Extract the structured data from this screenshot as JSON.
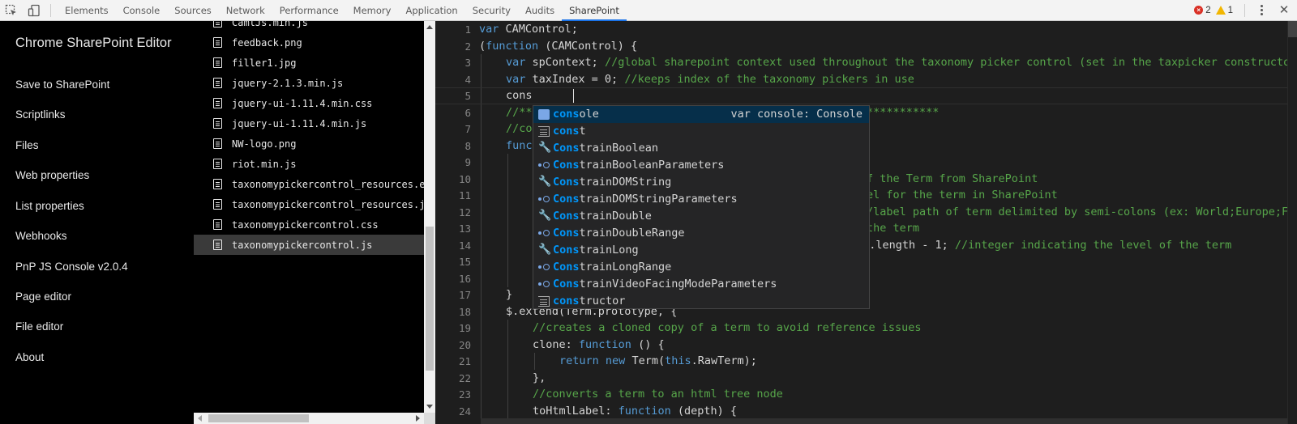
{
  "toolbar": {
    "tabs": [
      "Elements",
      "Console",
      "Sources",
      "Network",
      "Performance",
      "Memory",
      "Application",
      "Security",
      "Audits",
      "SharePoint"
    ],
    "active_tab": "SharePoint",
    "error_count": "2",
    "warning_count": "1",
    "colors": {
      "active_tab_underline": "#1a73e8",
      "error": "#d93025",
      "warning": "#f2b600"
    },
    "icons": [
      "inspect-element-icon",
      "device-toggle-icon",
      "error-icon",
      "warning-icon",
      "more-options-icon",
      "close-icon"
    ]
  },
  "nav": {
    "title": "Chrome SharePoint Editor",
    "items": [
      "Save to SharePoint",
      "Scriptlinks",
      "Files",
      "Web properties",
      "List properties",
      "Webhooks",
      "PnP JS Console v2.0.4",
      "Page editor",
      "File editor",
      "About"
    ]
  },
  "files": {
    "items": [
      "CamlJs.min.js",
      "feedback.png",
      "filler1.jpg",
      "jquery-2.1.3.min.js",
      "jquery-ui-1.11.4.min.css",
      "jquery-ui-1.11.4.min.js",
      "NW-logo.png",
      "riot.min.js",
      "taxonomypickercontrol_resources.en.js",
      "taxonomypickercontrol_resources.js",
      "taxonomypickercontrol.css",
      "taxonomypickercontrol.js"
    ],
    "selected": "taxonomypickercontrol.js"
  },
  "editor": {
    "line_numbers": [
      "1",
      "2",
      "3",
      "4",
      "5",
      "6",
      "7",
      "8",
      "9",
      "10",
      "11",
      "12",
      "13",
      "14",
      "15",
      "16",
      "17",
      "18",
      "19",
      "20",
      "21",
      "22",
      "23",
      "24"
    ],
    "current_line": 5,
    "typed_text": "cons",
    "colors": {
      "background": "#1e1e1e",
      "keyword": "#569cd6",
      "comment": "#57a64a",
      "text": "#d4d4d4",
      "line_number": "#858585"
    },
    "lines": {
      "l1": {
        "kw": "var",
        "rest": " CAMControl;"
      },
      "l2": {
        "a": "(",
        "kw": "function",
        "rest": " (CAMControl) {"
      },
      "l3": {
        "kw": "var",
        "rest": " spContext; ",
        "cm": "//global sharepoint context used throughout the taxonomy picker control (set in the taxpicker constructor)"
      },
      "l4": {
        "kw": "var",
        "rest": " taxIndex = 0; ",
        "cm": "//keeps index of the taxonomy pickers in use"
      },
      "l5": {
        "rest": "cons"
      },
      "l6": {
        "cm": "//**",
        "cm2": "***********"
      },
      "l7": {
        "cm": "//co"
      },
      "l8": {
        "kw": "func"
      },
      "l10": {
        "cm": "f the Term from SharePoint"
      },
      "l11": {
        "cm": "el for the term in SharePoint"
      },
      "l12": {
        "cm": "/label path of term delimited by semi-colons (ex: World;Europe;France)"
      },
      "l13": {
        "cm": "the term"
      },
      "l14": {
        "rest": "').length - 1; ",
        "cm": "//integer indicating the level of the term"
      },
      "l17": {
        "rest": "}"
      },
      "l18": {
        "rest": "$.extend(Term.prototype, {"
      },
      "l19": {
        "cm": "//creates a cloned copy of a term to avoid reference issues"
      },
      "l20": {
        "rest": "clone: ",
        "kw": "function",
        "rest2": " () {"
      },
      "l21": {
        "kw": "return",
        "kw2": "new",
        "a": " Term(",
        "kw3": "this",
        "rest": ".RawTerm);"
      },
      "l22": {
        "rest": "},"
      },
      "l23": {
        "cm": "//converts a term to an html tree node"
      },
      "l24": {
        "rest": "toHtmlLabel: ",
        "kw": "function",
        "rest2": " (depth) {"
      }
    }
  },
  "suggest": {
    "detail": "var console: Console",
    "items": [
      {
        "match": "cons",
        "rest": "ole",
        "icon": "variable-icon"
      },
      {
        "match": "cons",
        "rest": "t",
        "icon": "keyword-icon"
      },
      {
        "match": "Cons",
        "rest": "trainBoolean",
        "icon": "wrench-icon"
      },
      {
        "match": "Cons",
        "rest": "trainBooleanParameters",
        "icon": "interface-icon"
      },
      {
        "match": "Cons",
        "rest": "trainDOMString",
        "icon": "wrench-icon"
      },
      {
        "match": "Cons",
        "rest": "trainDOMStringParameters",
        "icon": "interface-icon"
      },
      {
        "match": "Cons",
        "rest": "trainDouble",
        "icon": "wrench-icon"
      },
      {
        "match": "Cons",
        "rest": "trainDoubleRange",
        "icon": "interface-icon"
      },
      {
        "match": "Cons",
        "rest": "trainLong",
        "icon": "wrench-icon"
      },
      {
        "match": "Cons",
        "rest": "trainLongRange",
        "icon": "interface-icon"
      },
      {
        "match": "Cons",
        "rest": "trainVideoFacingModeParameters",
        "icon": "interface-icon"
      },
      {
        "match": "cons",
        "rest": "tructor",
        "icon": "keyword-icon"
      }
    ],
    "colors": {
      "match_highlight": "#0097fb",
      "selected_bg": "#062f4a"
    }
  }
}
